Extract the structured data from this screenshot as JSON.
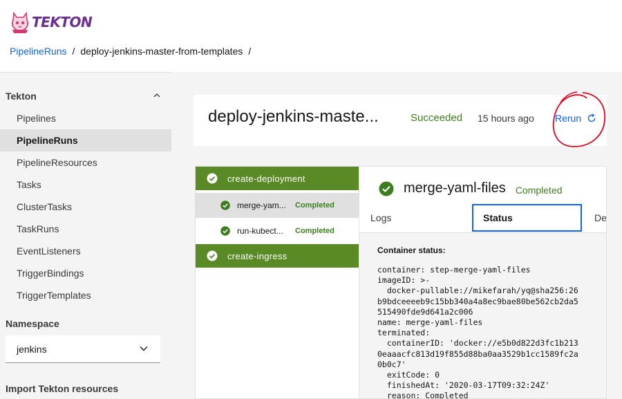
{
  "app": {
    "logo_text": "TEKTON"
  },
  "breadcrumb": {
    "items": [
      "PipelineRuns",
      "deploy-jenkins-master-from-templates"
    ],
    "separator": "/"
  },
  "sidebar": {
    "section_title": "Tekton",
    "items": [
      {
        "label": "Pipelines"
      },
      {
        "label": "PipelineRuns",
        "active": true
      },
      {
        "label": "PipelineResources"
      },
      {
        "label": "Tasks"
      },
      {
        "label": "ClusterTasks"
      },
      {
        "label": "TaskRuns"
      },
      {
        "label": "EventListeners"
      },
      {
        "label": "TriggerBindings"
      },
      {
        "label": "TriggerTemplates"
      }
    ],
    "namespace_label": "Namespace",
    "namespace_value": "jenkins",
    "import_label": "Import Tekton resources"
  },
  "run": {
    "title": "deploy-jenkins-maste...",
    "status": "Succeeded",
    "time": "15 hours ago",
    "rerun_label": "Rerun"
  },
  "tasks": [
    {
      "name": "create-deployment",
      "steps": [
        {
          "name": "merge-yam...",
          "status": "Completed",
          "selected": true
        },
        {
          "name": "run-kubect...",
          "status": "Completed"
        }
      ]
    },
    {
      "name": "create-ingress",
      "steps": []
    }
  ],
  "details": {
    "step_name": "merge-yaml-files",
    "step_status": "Completed",
    "tabs": [
      "Logs",
      "Status",
      "Details"
    ],
    "active_tab": "Status",
    "container_status_title": "Container status:",
    "yaml": "container: step-merge-yaml-files\nimageID: >-\n  docker-pullable://mikefarah/yq@sha256:26\nb9bdceeeeb9c15bb340a4a8ec9bae80be562cb2da5\n515490fde9d641a2c006\nname: merge-yaml-files\nterminated:\n  containerID: 'docker://e5b0d822d3fc1b213\n0eaaacfc813d19f855d88ba0aa3529b1cc1589fc2a\n0b0c7'\n  exitCode: 0\n  finishedAt: '2020-03-17T09:32:24Z'\n  reason: Completed"
  },
  "colors": {
    "accent": "#0f62fe",
    "success": "#3e7d1f",
    "task_green": "#5a8a26",
    "annotation_red": "#e3001b"
  }
}
